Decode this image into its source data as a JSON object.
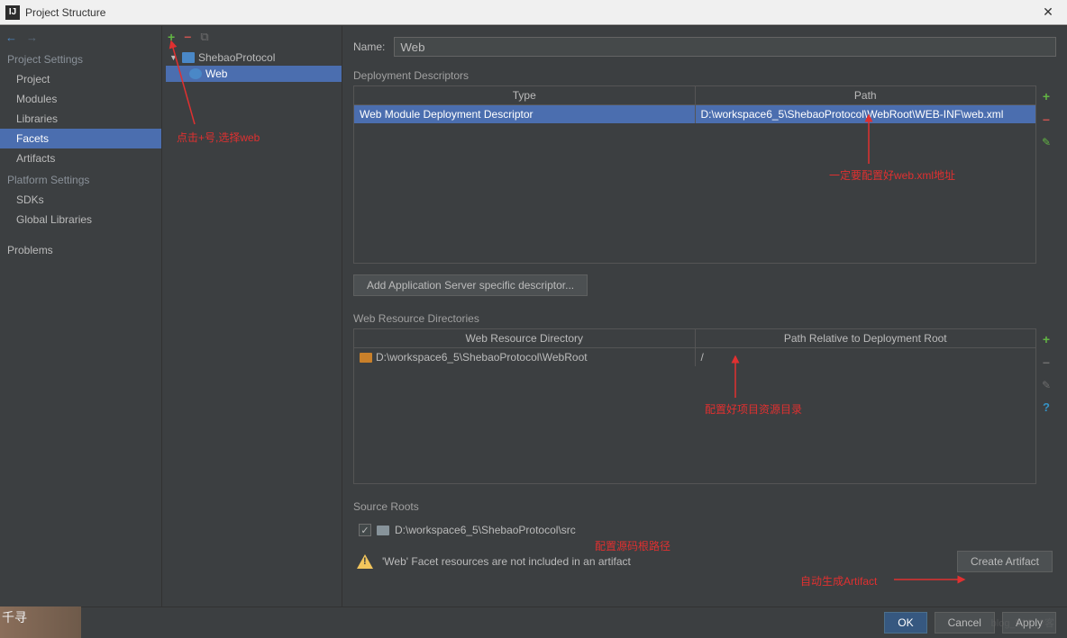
{
  "titlebar": {
    "title": "Project Structure"
  },
  "sidebar": {
    "sections": {
      "project_settings": "Project Settings",
      "platform_settings": "Platform Settings"
    },
    "items": {
      "project": "Project",
      "modules": "Modules",
      "libraries": "Libraries",
      "facets": "Facets",
      "artifacts": "Artifacts",
      "sdks": "SDKs",
      "global_libraries": "Global Libraries",
      "problems": "Problems"
    }
  },
  "tree": {
    "root": "ShebaoProtocol",
    "child": "Web"
  },
  "content": {
    "name_label": "Name:",
    "name_value": "Web",
    "deploy_section": "Deployment Descriptors",
    "deploy_headers": {
      "type": "Type",
      "path": "Path"
    },
    "deploy_row": {
      "type": "Web Module Deployment Descriptor",
      "path": "D:\\workspace6_5\\ShebaoProtocol\\WebRoot\\WEB-INF\\web.xml"
    },
    "add_server_btn": "Add Application Server specific descriptor...",
    "webres_section": "Web Resource Directories",
    "webres_headers": {
      "dir": "Web Resource Directory",
      "rel": "Path Relative to Deployment Root"
    },
    "webres_row": {
      "dir": "D:\\workspace6_5\\ShebaoProtocol\\WebRoot",
      "rel": "/"
    },
    "source_section": "Source Roots",
    "source_path": "D:\\workspace6_5\\ShebaoProtocol\\src",
    "warning_text": "'Web' Facet resources are not included in an artifact",
    "create_artifact_btn": "Create Artifact"
  },
  "footer": {
    "ok": "OK",
    "cancel": "Cancel",
    "apply": "Apply"
  },
  "annotations": {
    "anno1": "点击+号,选择web",
    "anno2": "一定要配置好web.xml地址",
    "anno3": "配置好项目资源目录",
    "anno4": "配置源码根路径",
    "anno5": "自动生成Artifact"
  },
  "watermark": {
    "corner": "千寻",
    "right": "blog_51C_?客"
  }
}
